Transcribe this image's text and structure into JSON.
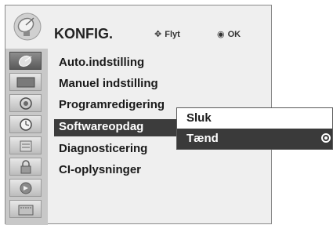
{
  "header": {
    "title": "KONFIG.",
    "hint_move": "Flyt",
    "hint_ok": "OK"
  },
  "sidebar": {
    "items": [
      {
        "icon": "satellite-dish-icon",
        "active": true
      },
      {
        "icon": "picture-icon",
        "active": false
      },
      {
        "icon": "speaker-icon",
        "active": false
      },
      {
        "icon": "clock-icon",
        "active": false
      },
      {
        "icon": "options-icon",
        "active": false
      },
      {
        "icon": "lock-icon",
        "active": false
      },
      {
        "icon": "input-icon",
        "active": false
      },
      {
        "icon": "usb-icon",
        "active": false
      }
    ]
  },
  "menu": {
    "items": [
      "Auto.indstilling",
      "Manuel indstilling",
      "Programredigering",
      "Softwareopdag",
      "Diagnosticering",
      "CI-oplysninger"
    ],
    "active_index": 3
  },
  "submenu": {
    "options": [
      "Sluk",
      "Tænd"
    ],
    "selected_index": 1
  },
  "colors": {
    "highlight": "#3c3c3c",
    "panel": "#efefef",
    "sidebar": "#c8c8c8"
  }
}
